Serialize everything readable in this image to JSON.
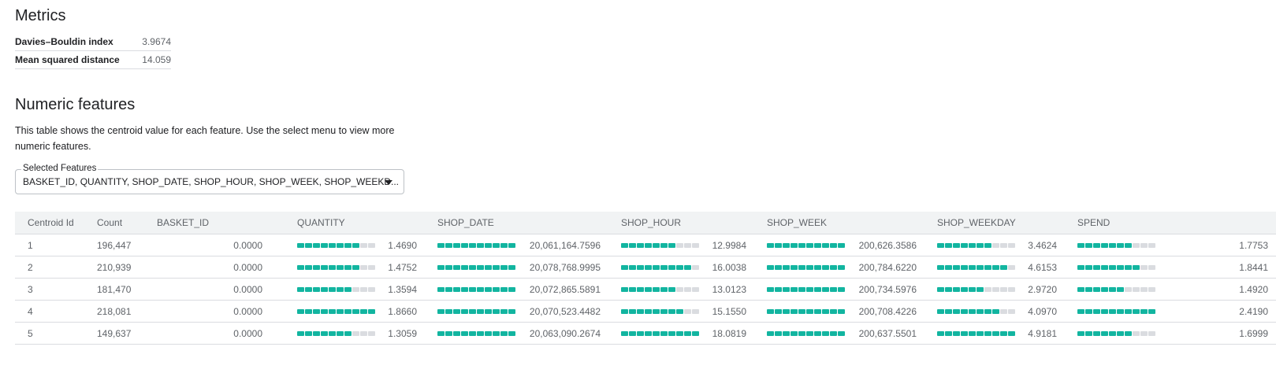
{
  "metrics": {
    "heading": "Metrics",
    "rows": [
      {
        "label": "Davies–Bouldin index",
        "value": "3.9674"
      },
      {
        "label": "Mean squared distance",
        "value": "14.059"
      }
    ]
  },
  "numeric": {
    "heading": "Numeric features",
    "description": "This table shows the centroid value for each feature. Use the select menu to view more numeric features.",
    "select": {
      "label": "Selected Features",
      "value": "BASKET_ID, QUANTITY, SHOP_DATE, SHOP_HOUR, SHOP_WEEK, SHOP_WEEKD..."
    },
    "columns": [
      "Centroid Id",
      "Count",
      "BASKET_ID",
      "QUANTITY",
      "SHOP_DATE",
      "SHOP_HOUR",
      "SHOP_WEEK",
      "SHOP_WEEKDAY",
      "SPEND"
    ],
    "bar_color": "#12b5a0",
    "rows": [
      {
        "id": "1",
        "count": "196,447",
        "basket_id": "0.0000",
        "cells": [
          {
            "value": "1.4690",
            "fill": 0.79
          },
          {
            "value": "20,061,164.7596",
            "fill": 1.0
          },
          {
            "value": "12.9984",
            "fill": 0.72
          },
          {
            "value": "200,626.3586",
            "fill": 1.0
          },
          {
            "value": "3.4624",
            "fill": 0.7
          },
          {
            "value": "1.7753",
            "fill": 0.73
          }
        ]
      },
      {
        "id": "2",
        "count": "210,939",
        "basket_id": "0.0000",
        "cells": [
          {
            "value": "1.4752",
            "fill": 0.79
          },
          {
            "value": "20,078,768.9995",
            "fill": 1.0
          },
          {
            "value": "16.0038",
            "fill": 0.89
          },
          {
            "value": "200,784.6220",
            "fill": 1.0
          },
          {
            "value": "4.6153",
            "fill": 0.94
          },
          {
            "value": "1.8441",
            "fill": 0.76
          }
        ]
      },
      {
        "id": "3",
        "count": "181,470",
        "basket_id": "0.0000",
        "cells": [
          {
            "value": "1.3594",
            "fill": 0.73
          },
          {
            "value": "20,072,865.5891",
            "fill": 1.0
          },
          {
            "value": "13.0123",
            "fill": 0.72
          },
          {
            "value": "200,734.5976",
            "fill": 1.0
          },
          {
            "value": "2.9720",
            "fill": 0.6
          },
          {
            "value": "1.4920",
            "fill": 0.62
          }
        ]
      },
      {
        "id": "4",
        "count": "218,081",
        "basket_id": "0.0000",
        "cells": [
          {
            "value": "1.8660",
            "fill": 1.0
          },
          {
            "value": "20,070,523.4482",
            "fill": 1.0
          },
          {
            "value": "15.1550",
            "fill": 0.84
          },
          {
            "value": "200,708.4226",
            "fill": 1.0
          },
          {
            "value": "4.0970",
            "fill": 0.83
          },
          {
            "value": "2.4190",
            "fill": 1.0
          }
        ]
      },
      {
        "id": "5",
        "count": "149,637",
        "basket_id": "0.0000",
        "cells": [
          {
            "value": "1.3059",
            "fill": 0.7
          },
          {
            "value": "20,063,090.2674",
            "fill": 1.0
          },
          {
            "value": "18.0819",
            "fill": 1.0
          },
          {
            "value": "200,637.5501",
            "fill": 1.0
          },
          {
            "value": "4.9181",
            "fill": 1.0
          },
          {
            "value": "1.6999",
            "fill": 0.7
          }
        ]
      }
    ]
  }
}
